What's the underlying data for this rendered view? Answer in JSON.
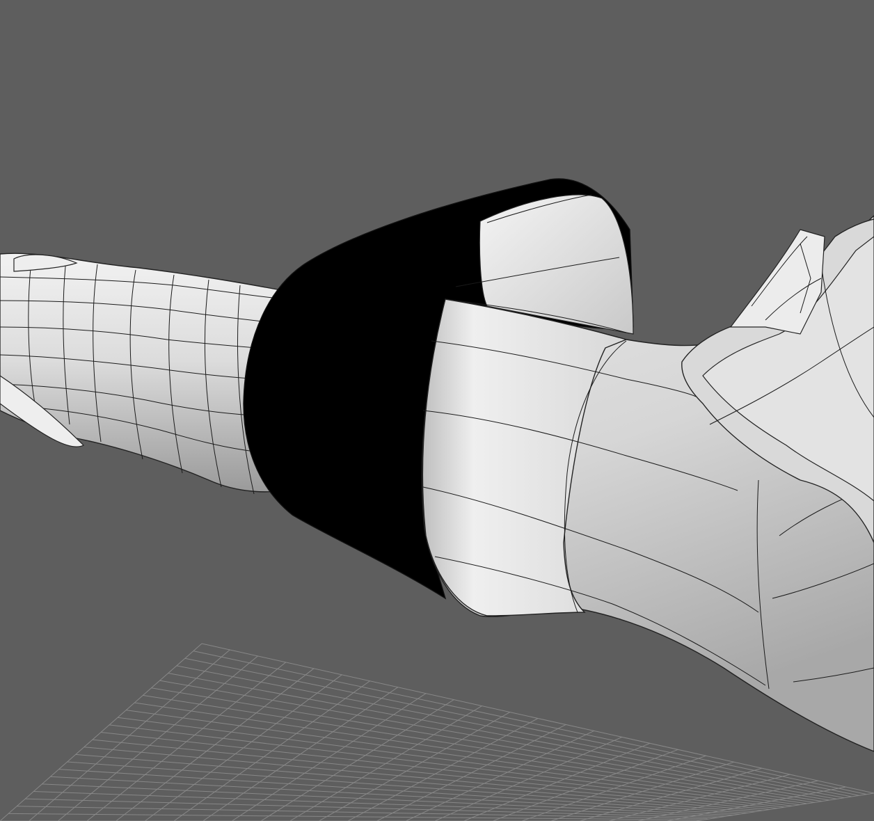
{
  "viewport": {
    "background_color": "#5e5e5e",
    "display_mode": "shaded-wireframe",
    "grid_visible": true,
    "grid_color": "#888888"
  },
  "scene": {
    "objects": [
      {
        "name": "forearm-mesh",
        "material_color": "#d8d8d8"
      },
      {
        "name": "sleeve-cuff",
        "material_color": "#e4e4e4",
        "interior_color": "#000000"
      },
      {
        "name": "hand-mesh",
        "material_color": "#dcdcdc"
      },
      {
        "name": "thumb-mesh",
        "material_color": "#e0e0e0"
      }
    ]
  }
}
